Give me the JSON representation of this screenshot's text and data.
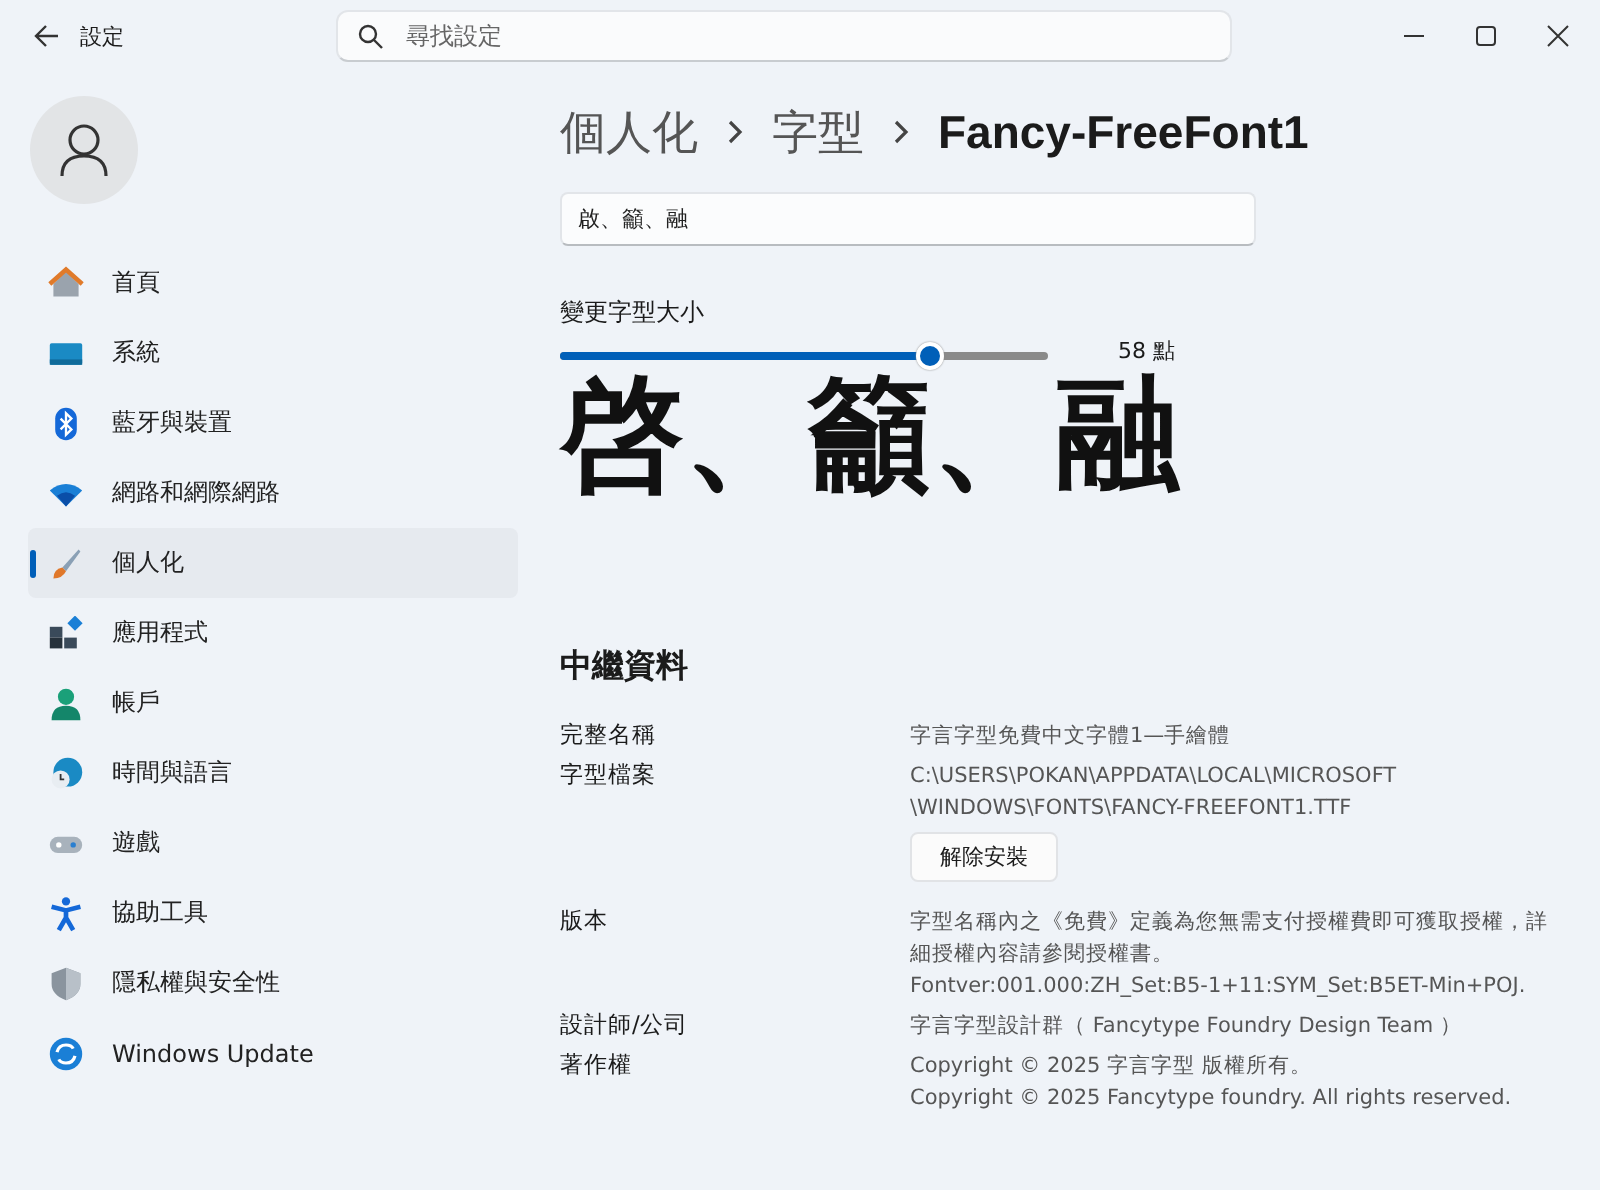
{
  "window": {
    "title": "設定"
  },
  "search": {
    "placeholder": "尋找設定"
  },
  "sidebar": {
    "items": [
      {
        "label": "首頁",
        "selected": false
      },
      {
        "label": "系統",
        "selected": false
      },
      {
        "label": "藍牙與裝置",
        "selected": false
      },
      {
        "label": "網路和網際網路",
        "selected": false
      },
      {
        "label": "個人化",
        "selected": true
      },
      {
        "label": "應用程式",
        "selected": false
      },
      {
        "label": "帳戶",
        "selected": false
      },
      {
        "label": "時間與語言",
        "selected": false
      },
      {
        "label": "遊戲",
        "selected": false
      },
      {
        "label": "協助工具",
        "selected": false
      },
      {
        "label": "隱私權與安全性",
        "selected": false
      },
      {
        "label": "Windows Update",
        "selected": false
      }
    ]
  },
  "breadcrumb": [
    "個人化",
    "字型",
    "Fancy-FreeFont1"
  ],
  "preview_field": {
    "value": "啟、籲、融"
  },
  "size": {
    "label": "變更字型大小",
    "level": 0.76,
    "reading": "58 點"
  },
  "sample_text": "啓、籲、融",
  "metadata": {
    "title": "中繼資料",
    "rows": [
      {
        "label": "完整名稱",
        "lines": [
          "字言字型免費中文字體1—手繪體"
        ]
      },
      {
        "label": "字型檔案",
        "lines": [
          "C:\\USERS\\POKAN\\APPDATA\\LOCAL\\MICROSOFT",
          "\\WINDOWS\\FONTS\\FANCY-FREEFONT1.TTF"
        ],
        "button": "解除安裝"
      },
      {
        "label": "版本",
        "lines": [
          "字型名稱內之《免費》定義為您無需支付授權費即可獲取授權，詳細授權內容請參閱授權書。",
          "Fontver:001.000:ZH_Set:B5-1+11:SYM_Set:B5ET-Min+POJ."
        ]
      },
      {
        "label": "設計師/公司",
        "lines": [
          "字言字型設計群（ Fancytype Foundry Design Team ）"
        ]
      },
      {
        "label": "著作權",
        "lines": [
          "Copyright © 2025 字言字型 版權所有。",
          "Copyright © 2025 Fancytype foundry. All rights reserved."
        ]
      }
    ]
  }
}
